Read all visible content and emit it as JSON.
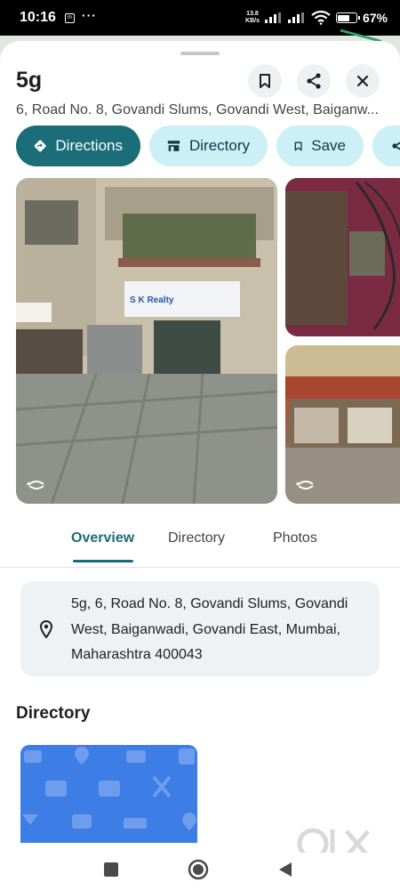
{
  "status_bar": {
    "time": "10:16",
    "net_speed_value": "13.8",
    "net_speed_unit": "KB/s",
    "battery_percent": "67%",
    "battery_level": 0.67
  },
  "place": {
    "title": "5g",
    "address_short": "6, Road No. 8, Govandi Slums, Govandi West, Baiganw...",
    "address_full": "5g, 6, Road No. 8, Govandi Slums, Govandi West, Baiganwadi, Govandi East, Mumbai, Maharashtra 400043"
  },
  "actions": {
    "directions": "Directions",
    "directory": "Directory",
    "save": "Save"
  },
  "photos": {
    "main_sign_text": "S K Realty"
  },
  "tabs": [
    "Overview",
    "Directory",
    "Photos"
  ],
  "active_tab": "Overview",
  "sections": {
    "directory_heading": "Directory"
  },
  "watermark": {
    "brand": "OLX"
  },
  "colors": {
    "accent": "#1b6d7a",
    "chip_tonal": "#cdeff6",
    "directory_tile": "#3d7de6"
  }
}
